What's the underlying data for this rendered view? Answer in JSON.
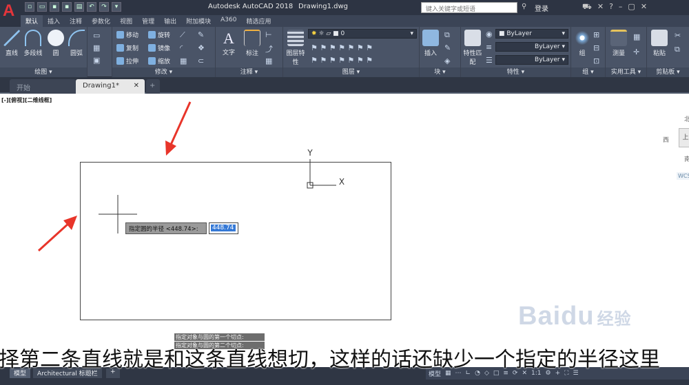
{
  "app": {
    "title": "Autodesk AutoCAD 2018",
    "document": "Drawing1.dwg",
    "logo": "A"
  },
  "titlebar": {
    "search_placeholder": "键入关键字或短语",
    "login": "登录"
  },
  "ribbon_tabs": [
    "默认",
    "插入",
    "注释",
    "参数化",
    "视图",
    "管理",
    "输出",
    "附加模块",
    "A360",
    "精选应用"
  ],
  "panels": {
    "draw": {
      "label": "绘图",
      "line": "直线",
      "polyline": "多段线",
      "circle": "圆",
      "arc": "圆弧"
    },
    "modify": {
      "label": "修改",
      "move": "移动",
      "rotate": "旋转",
      "copy": "复制",
      "mirror": "镜像",
      "stretch": "拉伸",
      "scale": "缩放"
    },
    "annotation": {
      "label": "注释",
      "text": "文字",
      "dimension": "标注"
    },
    "layers": {
      "label": "图层",
      "layer_properties": "图层特性",
      "current_layer": "0"
    },
    "block": {
      "label": "块",
      "insert": "插入"
    },
    "properties": {
      "label": "特性",
      "match": "特性匹配",
      "color": "ByLayer",
      "linetype": "ByLayer",
      "lineweight": "ByLayer"
    },
    "groups": {
      "label": "组",
      "group": "组"
    },
    "utilities": {
      "label": "实用工具",
      "measure": "测量"
    },
    "clipboard": {
      "label": "剪贴板",
      "paste": "粘贴"
    }
  },
  "file_tabs": {
    "start": "开始",
    "drawing": "Drawing1*",
    "add": "+"
  },
  "viewport": {
    "label": "[-][俯视][二维线框]"
  },
  "ucs": {
    "y": "Y",
    "x": "X"
  },
  "viewcube": {
    "north": "北",
    "top": "上",
    "west": "西",
    "south": "南",
    "wcs": "WCS"
  },
  "dynamic_input": {
    "prompt": "指定圆的半径 <448.74>:",
    "value": "448.74"
  },
  "command_history": [
    "指定对象与圆的第一个切点:",
    "指定对象与圆的第二个切点:"
  ],
  "layout_tabs": {
    "model": "模型",
    "layout": "Architectural 标题栏",
    "add": "+"
  },
  "status": {
    "model": "模型",
    "scale": "1:1"
  },
  "subtitle": "择第二条直线就是和这条直线想切，这样的话还缺少一个指定的半径这里",
  "watermark": {
    "brand": "Baidu",
    "suffix": "经验"
  },
  "colors": {
    "titlebar": "#2d3443",
    "ribbon": "#4a5467",
    "accent": "#e2353b",
    "selection": "#3579d6",
    "annotation_arrow": "#e8352a"
  }
}
